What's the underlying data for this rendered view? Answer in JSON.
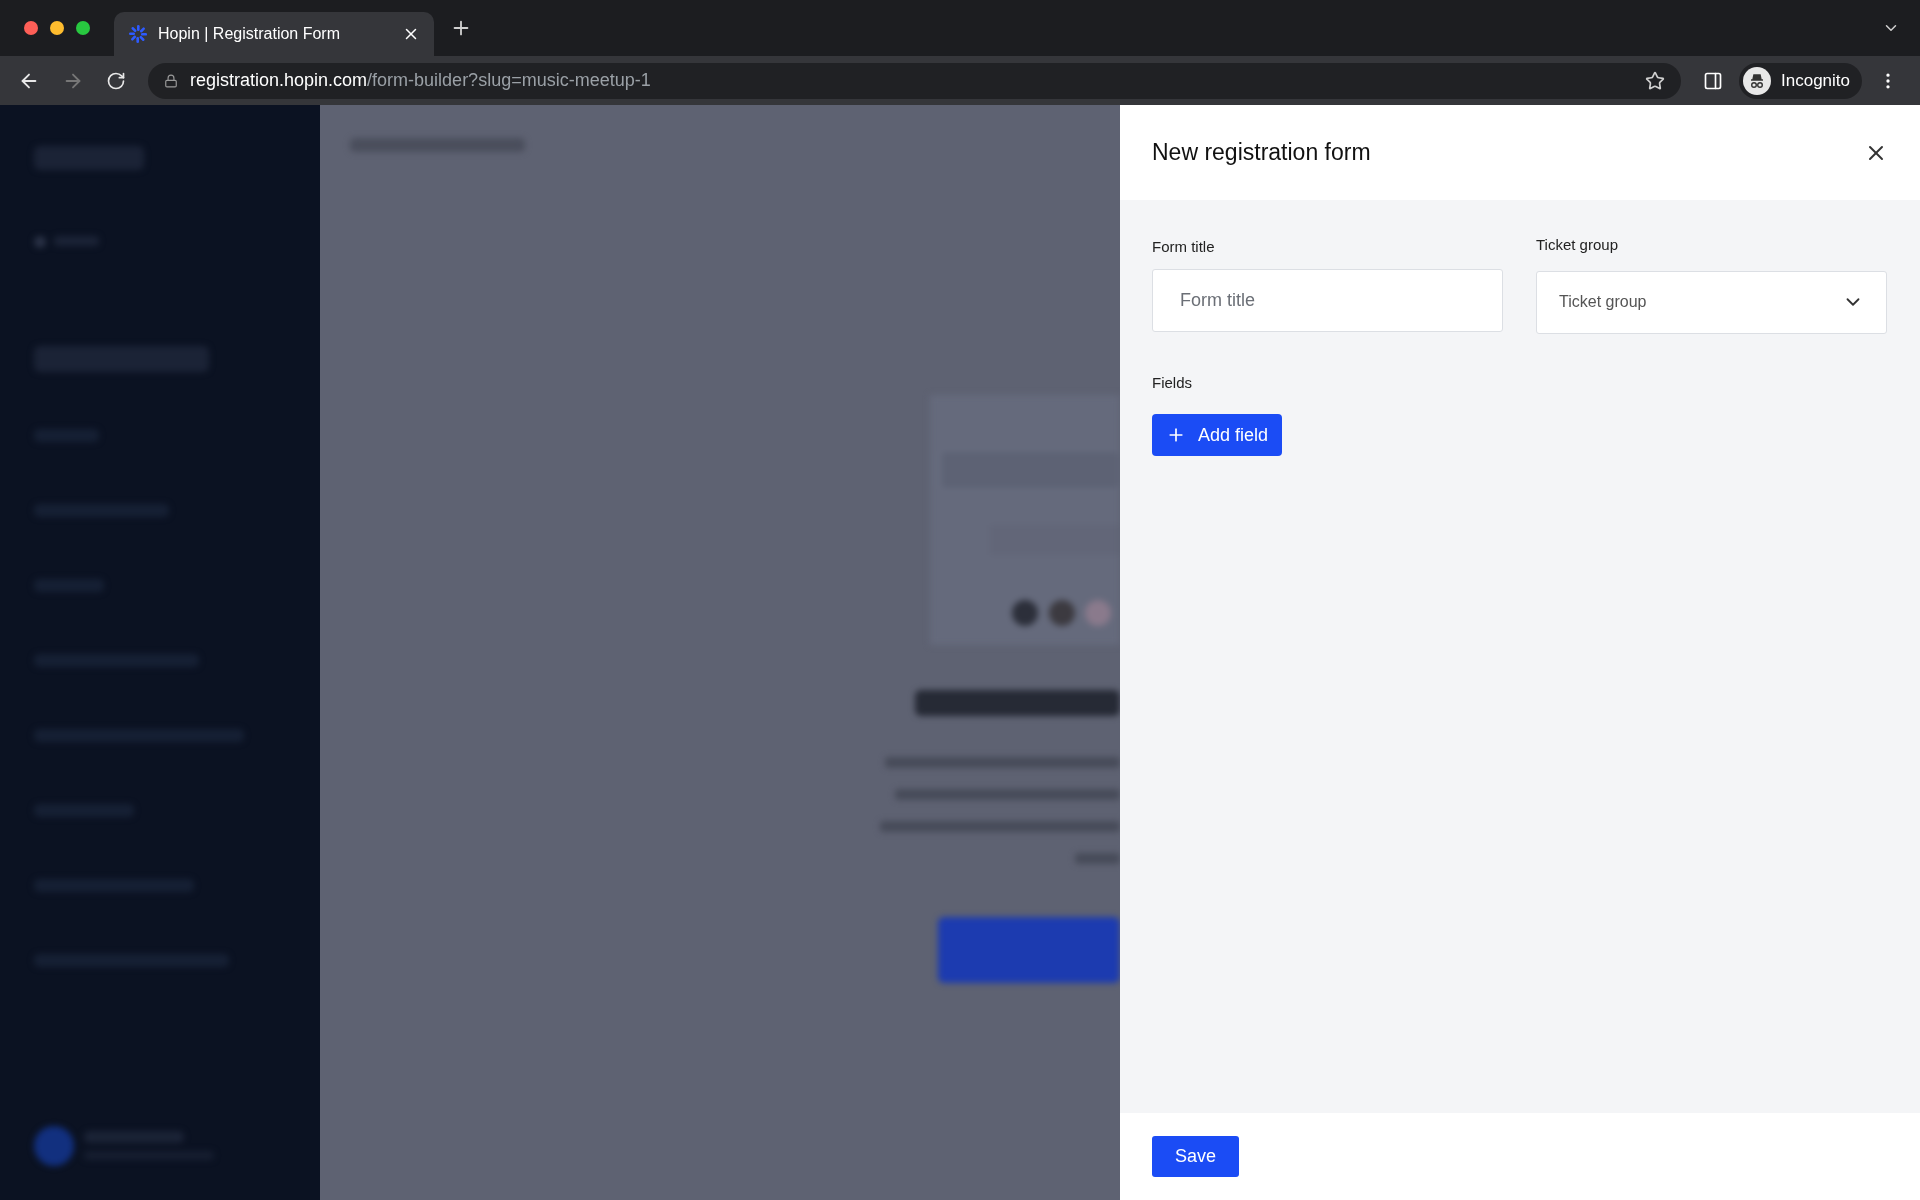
{
  "browser": {
    "tab": {
      "title": "Hopin | Registration Form",
      "selected": true
    },
    "url": {
      "host": "registration.hopin.com",
      "path": "/form-builder?slug=music-meetup-1"
    },
    "profile": "Incognito"
  },
  "drawer": {
    "title": "New registration form",
    "form_title": {
      "label": "Form title",
      "placeholder": "Form title"
    },
    "ticket_group": {
      "label": "Ticket group",
      "placeholder": "Ticket group"
    },
    "fields_label": "Fields",
    "add_button": "Add field",
    "save_button": "Save"
  }
}
